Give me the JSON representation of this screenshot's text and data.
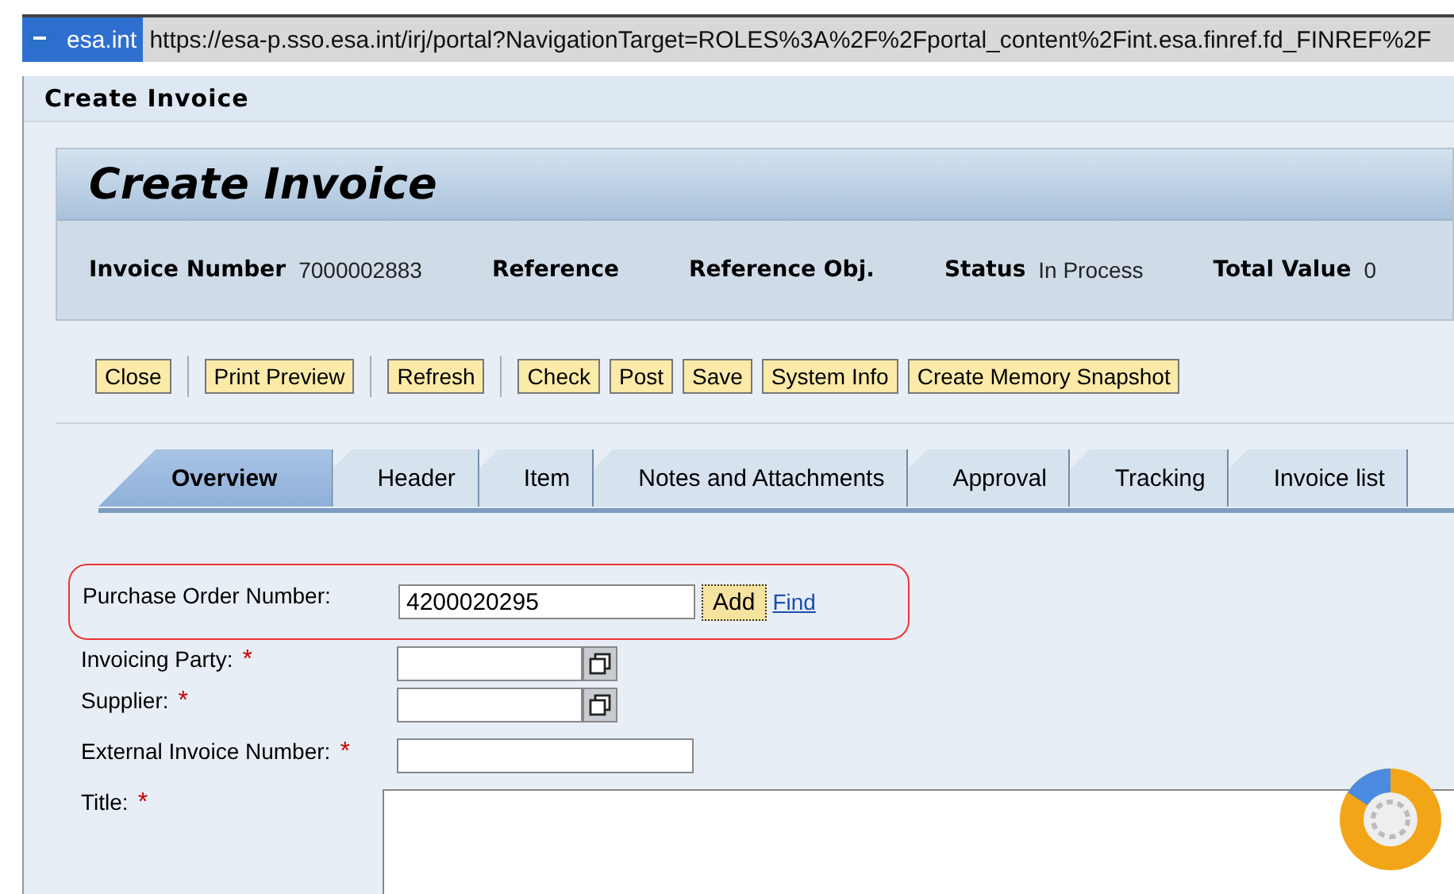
{
  "address_bar": {
    "site": "esa.int",
    "url": "https://esa-p.sso.esa.int/irj/portal?NavigationTarget=ROLES%3A%2F%2Fportal_content%2Fint.esa.finref.fd_FINREF%2F"
  },
  "page_title": "Create Invoice",
  "header": {
    "title": "Create Invoice",
    "fields": [
      {
        "label": "Invoice Number",
        "value": "7000002883"
      },
      {
        "label": "Reference"
      },
      {
        "label": "Reference Obj."
      },
      {
        "label": "Status",
        "value": "In Process"
      },
      {
        "label": "Total Value",
        "value": "0"
      }
    ]
  },
  "toolbar": [
    [
      "Close"
    ],
    [
      "Print Preview"
    ],
    [
      "Refresh"
    ],
    [
      "Check",
      "Post",
      "Save",
      "System Info",
      "Create Memory Snapshot"
    ]
  ],
  "tabs": [
    {
      "label": "Overview",
      "selected": true
    },
    {
      "label": "Header",
      "selected": false
    },
    {
      "label": "Item",
      "selected": false
    },
    {
      "label": "Notes and Attachments",
      "selected": false
    },
    {
      "label": "Approval",
      "selected": false
    },
    {
      "label": "Tracking",
      "selected": false
    },
    {
      "label": "Invoice list",
      "selected": false
    }
  ],
  "purchase_order": {
    "label": "Purchase Order Number:",
    "value": "4200020295",
    "add_button": "Add",
    "find_link": "Find"
  },
  "fields": [
    {
      "label": "Invoicing Party:",
      "required_mark": "*",
      "kind": "lookup"
    },
    {
      "label": "Supplier:",
      "required_mark": "*",
      "kind": "lookup"
    },
    {
      "label": "External Invoice Number:",
      "required_mark": "*",
      "kind": "text"
    },
    {
      "label": "Title:",
      "required_mark": "*",
      "kind": "textarea"
    }
  ]
}
